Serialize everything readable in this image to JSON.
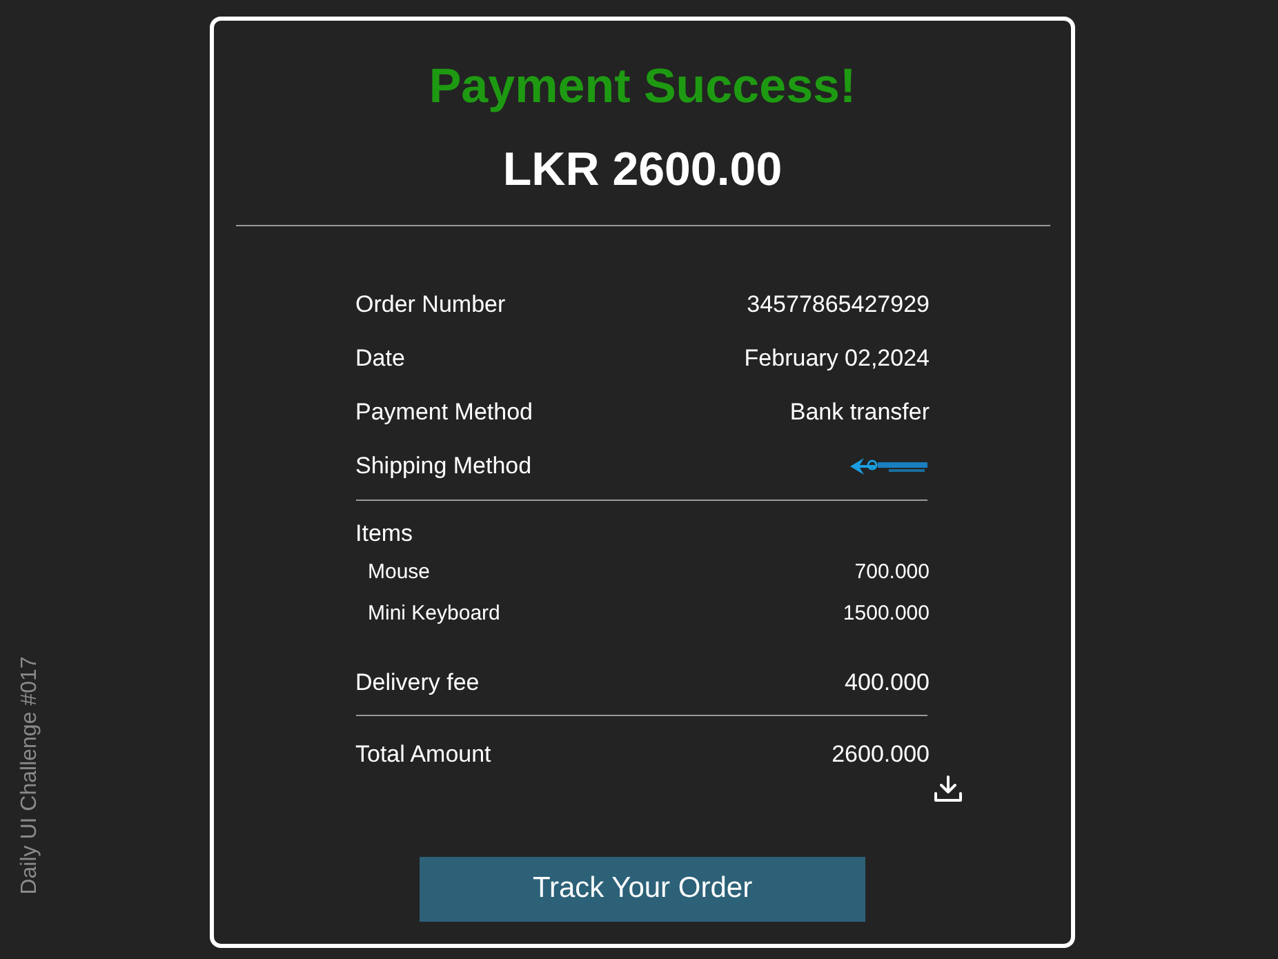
{
  "side_label": "Daily UI Challenge #017",
  "title": "Payment Success!",
  "amount": "LKR 2600.00",
  "details": [
    {
      "label": "Order Number",
      "value": "34577865427929",
      "kind": "text"
    },
    {
      "label": "Date",
      "value": "February 02,2024",
      "kind": "text"
    },
    {
      "label": "Payment Method",
      "value": "Bank transfer",
      "kind": "text"
    },
    {
      "label": "Shipping Method",
      "kind": "logo"
    }
  ],
  "items_heading": "Items",
  "items": [
    {
      "name": "Mouse",
      "price": "700.000"
    },
    {
      "name": "Mini Keyboard",
      "price": "1500.000"
    }
  ],
  "delivery": {
    "label": "Delivery fee",
    "value": "400.000"
  },
  "total": {
    "label": "Total Amount",
    "value": "2600.000"
  },
  "button": "Track Your Order"
}
